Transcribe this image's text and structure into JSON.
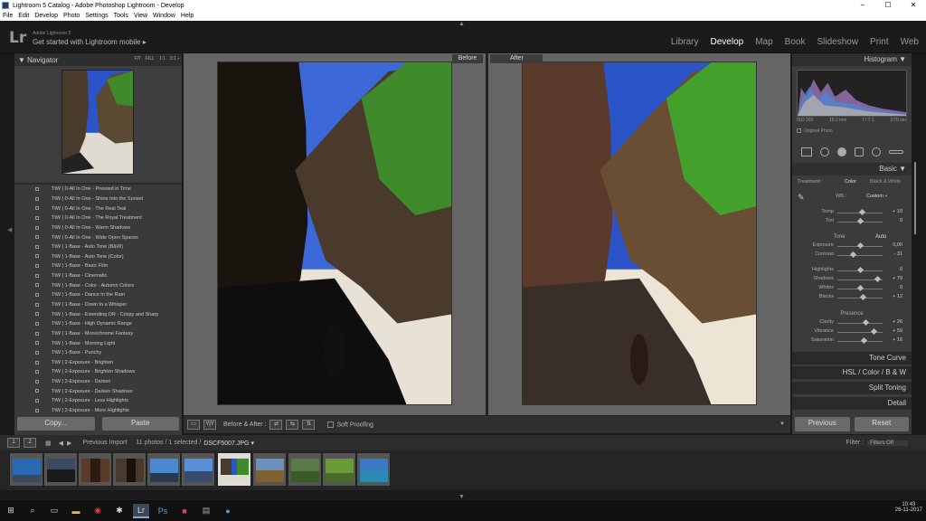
{
  "window": {
    "title": "Lightroom 5 Catalog - Adobe Photoshop Lightroom - Develop",
    "controls": [
      "–",
      "☐",
      "✕"
    ]
  },
  "menu": [
    "File",
    "Edit",
    "Develop",
    "Photo",
    "Settings",
    "Tools",
    "View",
    "Window",
    "Help"
  ],
  "identity": {
    "logo": "Lr",
    "sub": "Adobe Lightroom 5",
    "mobile": "Get started with Lightroom mobile ▸"
  },
  "modules": [
    "Library",
    "Develop",
    "Map",
    "Book",
    "Slideshow",
    "Print",
    "Web"
  ],
  "navigator": {
    "title": "Navigator",
    "options": [
      "FIT",
      "FILL",
      "1:1",
      "3:1 ÷"
    ]
  },
  "presets": [
    "TtW | 0-All In One - Pressed in Time",
    "TtW | 0-All In One - Shine Into the Sunset",
    "TtW | 0-All In One - The Real Teal",
    "TtW | 0-All In One - The Royal Treatment",
    "TtW | 0-All In One - Warm Shadows",
    "TtW | 0-All In One - Wide Open Spaces",
    "TtW | 1-Base - Auto Tone (B&W)",
    "TtW | 1-Base - Auto Tone (Color)",
    "TtW | 1-Base - Basic Film",
    "TtW | 1-Base - Cinematic",
    "TtW | 1-Base - Color - Autumn Colors",
    "TtW | 1-Base - Dance In the Rain",
    "TtW | 1-Base - Down to a Whisper",
    "TtW | 1-Base - Extending DR - Crispy and Sharp",
    "TtW | 1-Base - High Dynamic Range",
    "TtW | 1-Base - Monochrome Fantasy",
    "TtW | 1-Base - Morning Light",
    "TtW | 1-Base - Punchy",
    "TtW | 2-Exposure - Brighten",
    "TtW | 2-Exposure - Brighten Shadows",
    "TtW | 2-Exposure - Darken",
    "TtW | 2-Exposure - Darken Shadows",
    "TtW | 2-Exposure - Less Highlights",
    "TtW | 2-Exposure - More Highlights"
  ],
  "left_buttons": {
    "copy": "Copy...",
    "paste": "Paste"
  },
  "compare": {
    "before": "Before",
    "after": "After"
  },
  "toolbar": {
    "view_mode": "Y|Y",
    "ba_label": "Before & After :",
    "soft_proof": "Soft Proofing"
  },
  "histogram": {
    "title": "Histogram",
    "iso": "ISO 200",
    "focal": "18.2 mm",
    "fstop": "f / 7.1",
    "shutter": "1/70 sec",
    "original": "Original Photo"
  },
  "basic": {
    "title": "Basic",
    "treatment_label": "Treatment :",
    "color": "Color",
    "bw": "Black & White",
    "wb_label": "WB :",
    "wb_value": "Custom ÷",
    "tone_label": "Tone",
    "auto": "Auto",
    "presence": "Presence",
    "sliders": [
      {
        "label": "Temp",
        "value": "+ 10",
        "pos": 0.55
      },
      {
        "label": "Tint",
        "value": "0",
        "pos": 0.5
      },
      {
        "label": "Exposure",
        "value": "0,00",
        "pos": 0.5
      },
      {
        "label": "Contrast",
        "value": "- 31",
        "pos": 0.35
      },
      {
        "label": "Highlights",
        "value": "0",
        "pos": 0.5
      },
      {
        "label": "Shadows",
        "value": "+ 79",
        "pos": 0.89
      },
      {
        "label": "Whites",
        "value": "0",
        "pos": 0.5
      },
      {
        "label": "Blacks",
        "value": "+ 12",
        "pos": 0.56
      },
      {
        "label": "Clarity",
        "value": "+ 26",
        "pos": 0.63
      },
      {
        "label": "Vibrance",
        "value": "+ 59",
        "pos": 0.8
      },
      {
        "label": "Saturation",
        "value": "+ 16",
        "pos": 0.58
      }
    ]
  },
  "panels": {
    "tone_curve": "Tone Curve",
    "hsl": "HSL  /  Color  /  B & W",
    "split_toning": "Split Toning",
    "detail": "Detail"
  },
  "right_buttons": {
    "previous": "Previous",
    "reset": "Reset"
  },
  "filmbar": {
    "source": "Previous Import",
    "count": "11 photos / 1 selected /",
    "file": "DSCF5007.JPG ▾",
    "filter_label": "Filter :",
    "filter_value": "Filters Off"
  },
  "clock": {
    "time": "10:43",
    "date": "26-11-2017"
  },
  "colors": {
    "sky": "#2a54c8",
    "rock": "#4a3a2c",
    "green": "#3f8a2a",
    "sand": "#e8e2d6",
    "panel": "#3b3b3b"
  }
}
